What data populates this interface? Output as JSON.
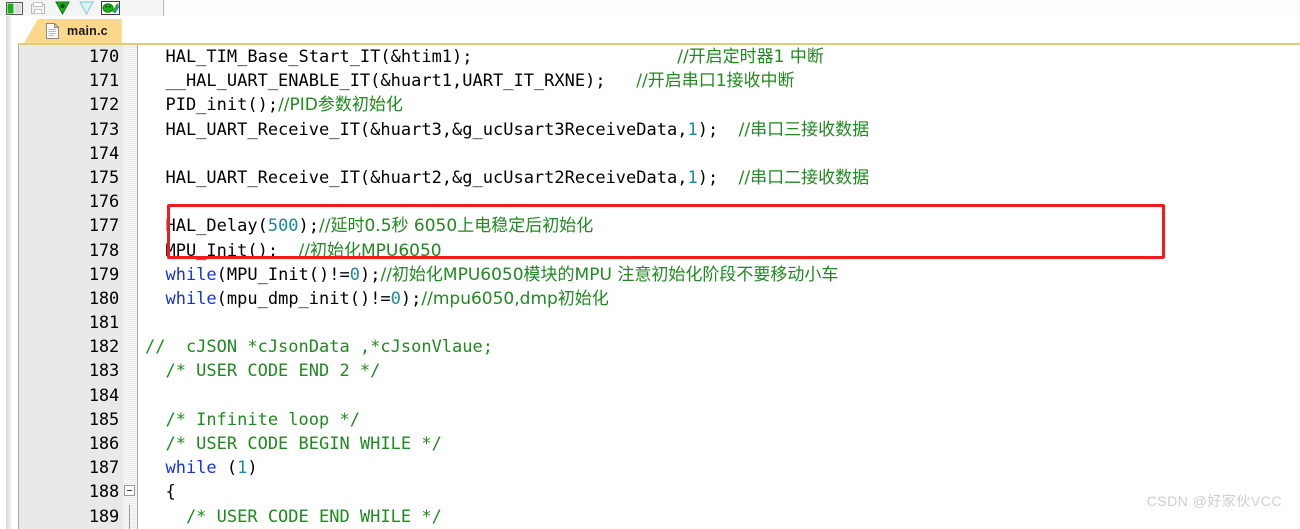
{
  "toolbar": {
    "buttons": [
      {
        "name": "window-layout-icon",
        "title": "Window Layout"
      },
      {
        "name": "save-all-icon",
        "title": "Save All"
      },
      {
        "name": "bookmark-down-icon",
        "title": "Next Bookmark"
      },
      {
        "name": "bookmark-filter-icon",
        "title": "Filter Bookmark"
      },
      {
        "name": "debug-bug-icon",
        "title": "Start Debug"
      }
    ]
  },
  "tab": {
    "label": "main.c",
    "icon": "c-file-icon"
  },
  "editor": {
    "first_line": 170,
    "fold_line": 188,
    "lines": [
      {
        "n": "170",
        "tokens": [
          {
            "t": "  HAL_TIM_Base_Start_IT(&htim1);                    ",
            "c": ""
          },
          {
            "t": "//开启定时器1 中断",
            "c": "cmt-cn"
          }
        ]
      },
      {
        "n": "171",
        "tokens": [
          {
            "t": "  __HAL_UART_ENABLE_IT(&huart1,UART_IT_RXNE);   ",
            "c": ""
          },
          {
            "t": "//开启串口1接收中断",
            "c": "cmt-cn"
          }
        ]
      },
      {
        "n": "172",
        "tokens": [
          {
            "t": "  PID_init();",
            "c": ""
          },
          {
            "t": "//PID参数初始化",
            "c": "cmt-cn"
          }
        ]
      },
      {
        "n": "173",
        "tokens": [
          {
            "t": "  HAL_UART_Receive_IT(&huart3,&g_ucUsart3ReceiveData,",
            "c": ""
          },
          {
            "t": "1",
            "c": "num"
          },
          {
            "t": ");  ",
            "c": ""
          },
          {
            "t": "//串口三接收数据",
            "c": "cmt-cn"
          }
        ]
      },
      {
        "n": "174",
        "tokens": [
          {
            "t": "",
            "c": ""
          }
        ]
      },
      {
        "n": "175",
        "tokens": [
          {
            "t": "  HAL_UART_Receive_IT(&huart2,&g_ucUsart2ReceiveData,",
            "c": ""
          },
          {
            "t": "1",
            "c": "num"
          },
          {
            "t": ");  ",
            "c": ""
          },
          {
            "t": "//串口二接收数据",
            "c": "cmt-cn"
          }
        ]
      },
      {
        "n": "176",
        "tokens": [
          {
            "t": "",
            "c": ""
          }
        ]
      },
      {
        "n": "177",
        "tokens": [
          {
            "t": "  HAL_Delay(",
            "c": ""
          },
          {
            "t": "500",
            "c": "num"
          },
          {
            "t": ");",
            "c": ""
          },
          {
            "t": "//延时0.5秒 6050上电稳定后初始化",
            "c": "cmt-cn"
          }
        ]
      },
      {
        "n": "178",
        "tokens": [
          {
            "t": "  MPU_Init();  ",
            "c": ""
          },
          {
            "t": "//初始化MPU6050",
            "c": "cmt-cn"
          }
        ]
      },
      {
        "n": "179",
        "tokens": [
          {
            "t": "  ",
            "c": ""
          },
          {
            "t": "while",
            "c": "kw"
          },
          {
            "t": "(MPU_Init()!=",
            "c": ""
          },
          {
            "t": "0",
            "c": "num"
          },
          {
            "t": ");",
            "c": ""
          },
          {
            "t": "//初始化MPU6050模块的MPU 注意初始化阶段不要移动小车",
            "c": "cmt-cn"
          }
        ]
      },
      {
        "n": "180",
        "tokens": [
          {
            "t": "  ",
            "c": ""
          },
          {
            "t": "while",
            "c": "kw"
          },
          {
            "t": "(mpu_dmp_init()!=",
            "c": ""
          },
          {
            "t": "0",
            "c": "num"
          },
          {
            "t": ");",
            "c": ""
          },
          {
            "t": "//mpu6050,dmp初始化",
            "c": "cmt-cn"
          }
        ]
      },
      {
        "n": "181",
        "tokens": [
          {
            "t": "",
            "c": ""
          }
        ]
      },
      {
        "n": "182",
        "tokens": [
          {
            "t": "//  cJSON *cJsonData ,*cJsonVlaue;",
            "c": "cmt"
          }
        ]
      },
      {
        "n": "183",
        "tokens": [
          {
            "t": "  /* USER CODE END 2 */",
            "c": "cmt"
          }
        ]
      },
      {
        "n": "184",
        "tokens": [
          {
            "t": "",
            "c": ""
          }
        ]
      },
      {
        "n": "185",
        "tokens": [
          {
            "t": "  /* Infinite loop */",
            "c": "cmt"
          }
        ]
      },
      {
        "n": "186",
        "tokens": [
          {
            "t": "  /* USER CODE BEGIN WHILE */",
            "c": "cmt"
          }
        ]
      },
      {
        "n": "187",
        "tokens": [
          {
            "t": "  ",
            "c": ""
          },
          {
            "t": "while",
            "c": "kw"
          },
          {
            "t": " (",
            "c": ""
          },
          {
            "t": "1",
            "c": "num"
          },
          {
            "t": ")",
            "c": ""
          }
        ]
      },
      {
        "n": "188",
        "fold": true,
        "tokens": [
          {
            "t": "  {",
            "c": ""
          }
        ]
      },
      {
        "n": "189",
        "foldline": true,
        "tokens": [
          {
            "t": "    /* USER CODE END WHILE */",
            "c": "cmt"
          }
        ]
      }
    ]
  },
  "annotation": {
    "type": "red-rectangle-highlight",
    "targets_line": "175",
    "color": "#f21b1b"
  },
  "watermark": {
    "text": "CSDN @好家伙VCC"
  }
}
